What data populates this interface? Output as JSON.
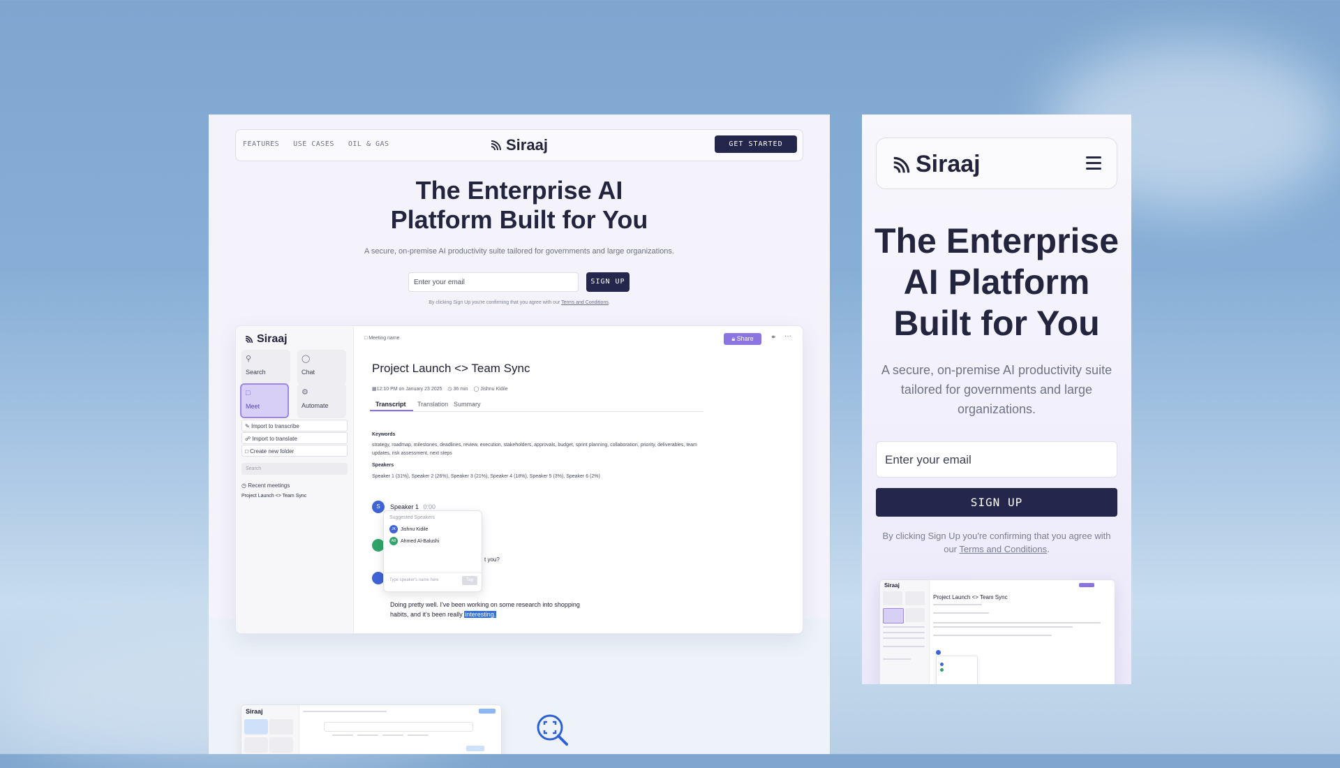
{
  "brand": {
    "name": "Siraaj"
  },
  "desktop": {
    "nav": {
      "links": [
        "FEATURES",
        "USE CASES",
        "OIL & GAS"
      ],
      "cta": "GET STARTED"
    },
    "hero": {
      "title_line1": "The Enterprise AI",
      "title_line2": "Platform Built for You",
      "subtitle": "A secure, on-premise AI productivity suite tailored for governments and large organizations.",
      "email_placeholder": "Enter your email",
      "signup": "SIGN UP",
      "consent": "By clicking Sign Up you're confirming that you agree with our",
      "terms": "Terms and Conditions",
      "consent_end": "."
    },
    "app": {
      "sidebar": {
        "tiles": [
          "Search",
          "Chat",
          "Meet",
          "Automate"
        ],
        "actions": [
          "Import to transcribe",
          "Import to translate",
          "Create new folder"
        ],
        "search_placeholder": "Search",
        "recent_heading": "Recent meetings",
        "recent_items": [
          "Project Launch <> Team Sync"
        ]
      },
      "header": {
        "meeting_name": "Meeting name",
        "share": "Share"
      },
      "meeting": {
        "title": "Project Launch <> Team Sync",
        "time": "12:10 PM on January 23 2025",
        "duration": "36 min",
        "owner": "Jishnu Kidile"
      },
      "tabs": [
        "Transcript",
        "Translation",
        "Summary"
      ],
      "keywords_label": "Keywords",
      "keywords": "strategy, roadmap, milestones, deadlines, review, execution, stakeholders, approvals, budget, sprint planning, collaboration, priority, deliverables, team updates, risk assessment, next steps",
      "speakers_label": "Speakers",
      "speakers": "Speaker 1 (31%), Speaker 2 (26%), Speaker 3 (21%), Speaker 4 (18%), Speaker 5 (3%), Speaker 6 (2%)",
      "transcript": {
        "speaker": "Speaker 1",
        "timestamp": "0:00",
        "avatar_letter": "S",
        "fragment": "t you?",
        "line1": "Doing pretty well. I've been working on some research into shopping",
        "line2": "habits, and it's been really",
        "highlight": "interesting."
      },
      "popup": {
        "heading": "Suggested Speakers",
        "people": [
          {
            "initials": "JK",
            "name": "Jishnu Kidile"
          },
          {
            "initials": "AB",
            "name": "Ahmed Al-Balushi"
          }
        ],
        "input_placeholder": "Type speaker's name here",
        "tag": "Tag"
      }
    }
  },
  "mobile": {
    "title_line1": "The Enterprise",
    "title_line2": "AI Platform",
    "title_line3": "Built for You",
    "subtitle": "A secure, on-premise AI productivity suite tailored for governments and large organizations.",
    "email_placeholder": "Enter your email",
    "signup": "SIGN UP",
    "consent": "By clicking Sign Up you're confirming that you agree with our",
    "terms": "Terms and Conditions",
    "consent_end": "."
  },
  "colors": {
    "primary": "#24264b",
    "accent": "#8b74e0",
    "link_blue": "#2f6fdd",
    "avatar_blue": "#3f64d6",
    "avatar_green": "#2fa56b"
  }
}
